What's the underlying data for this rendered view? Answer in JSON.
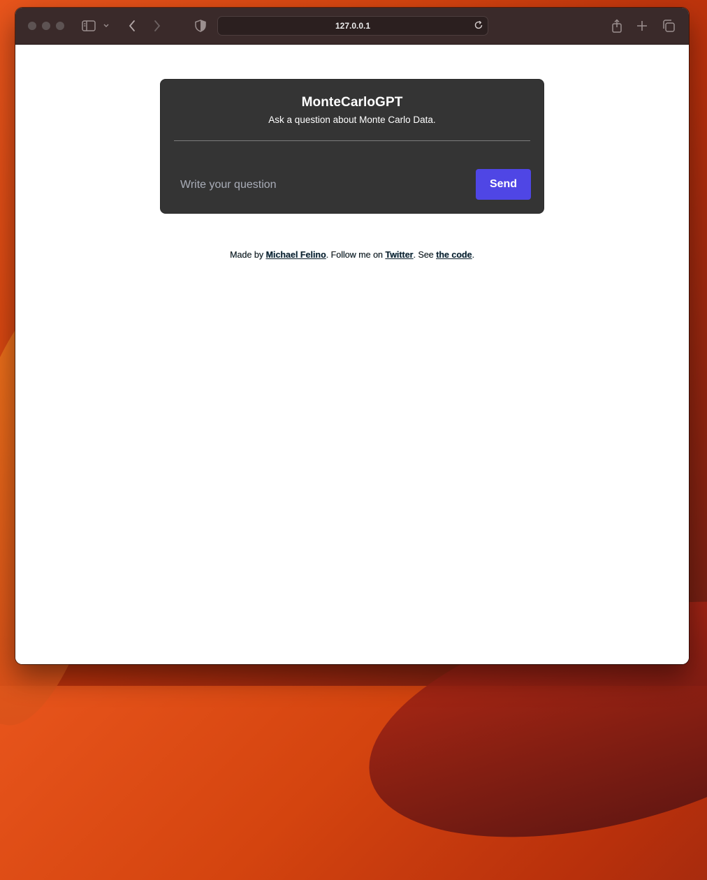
{
  "browser": {
    "url": "127.0.0.1",
    "icons": [
      "sidebar-icon",
      "chevron-down-icon",
      "back-arrow-icon",
      "forward-arrow-icon",
      "privacy-shield-icon",
      "reload-icon",
      "share-icon",
      "new-tab-plus-icon",
      "tabs-overview-icon"
    ]
  },
  "card": {
    "title": "MonteCarloGPT",
    "subtitle": "Ask a question about Monte Carlo Data.",
    "input_placeholder": "Write your question",
    "input_value": "",
    "send_label": "Send"
  },
  "footer": {
    "made_by": "Made by",
    "author": "Michael Felino",
    "follow_text": ". Follow me on",
    "twitter": "Twitter",
    "see_text": ". See",
    "code_link": "the code",
    "end": "."
  },
  "colors": {
    "card_bg": "#343434",
    "send_button": "#4f46e5",
    "toolbar_bg": "#3a2a2a"
  }
}
